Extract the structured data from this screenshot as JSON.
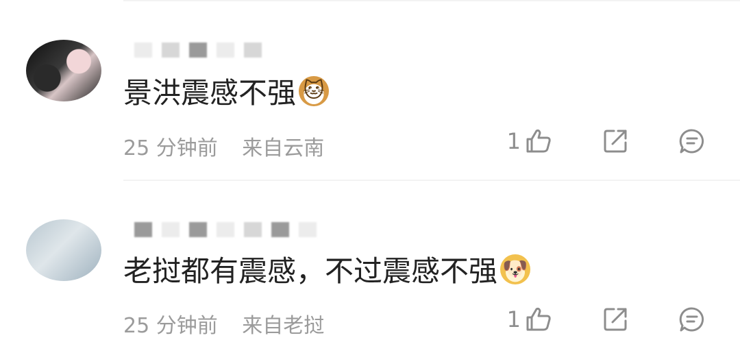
{
  "comments": [
    {
      "text": "景洪震感不强",
      "emoji_icon": "cat-face-emoji",
      "emoji_glyph": "🐱",
      "time": "25 分钟前",
      "location": "来自云南",
      "likes": "1"
    },
    {
      "text": "老挝都有震感，不过震感不强",
      "emoji_icon": "doge-emoji",
      "emoji_glyph": "🐶",
      "time": "25 分钟前",
      "location": "来自老挝",
      "likes": "1"
    }
  ],
  "icons": {
    "like": "thumbs-up-icon",
    "share": "share-icon",
    "reply": "comment-icon"
  },
  "colors": {
    "text": "#222222",
    "meta": "#9b9b9b",
    "icon": "#8d8d8d",
    "divider": "#f3f3f3"
  }
}
